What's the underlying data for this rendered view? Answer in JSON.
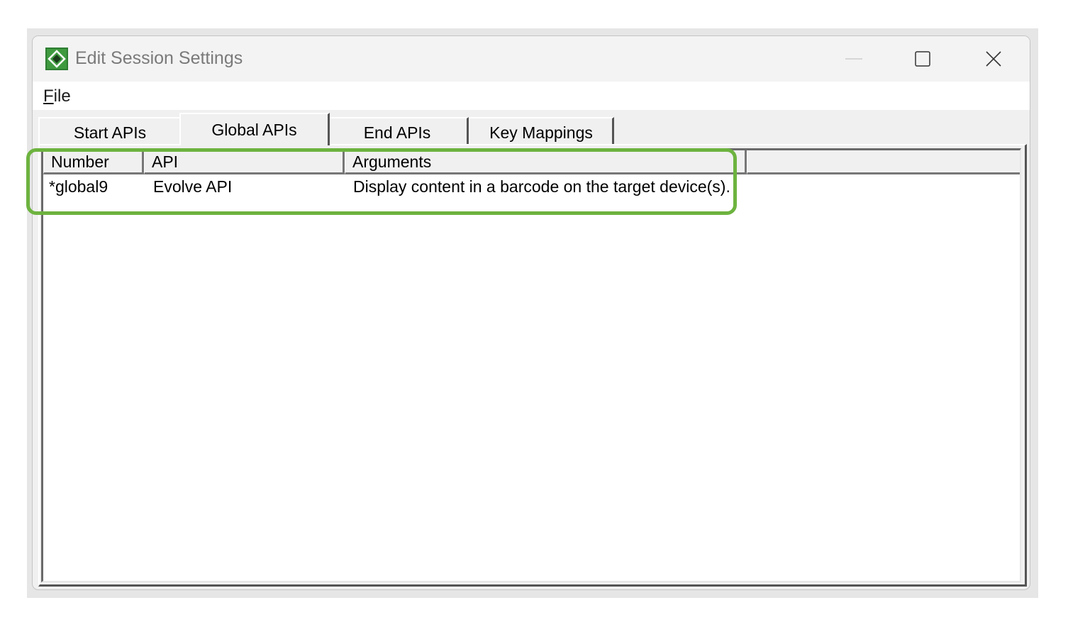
{
  "window": {
    "title": "Edit Session Settings",
    "app_icon": "app-diamond-icon",
    "controls": [
      "minimize-icon",
      "maximize-icon",
      "close-icon"
    ]
  },
  "menu": {
    "file_prefix": "F",
    "file_rest": "ile"
  },
  "tabs": [
    {
      "label": "Start APIs",
      "selected": false
    },
    {
      "label": "Global APIs",
      "selected": true
    },
    {
      "label": "End APIs",
      "selected": false
    },
    {
      "label": "Key Mappings",
      "selected": false
    }
  ],
  "table": {
    "columns": [
      "Number",
      "API",
      "Arguments",
      ""
    ],
    "rows": [
      {
        "number": "*global9",
        "api": "Evolve API",
        "arguments": "Display content in a barcode on the target device(s)."
      }
    ]
  },
  "colors": {
    "highlight": "#6db33f",
    "title_text": "#7a7a7a"
  }
}
